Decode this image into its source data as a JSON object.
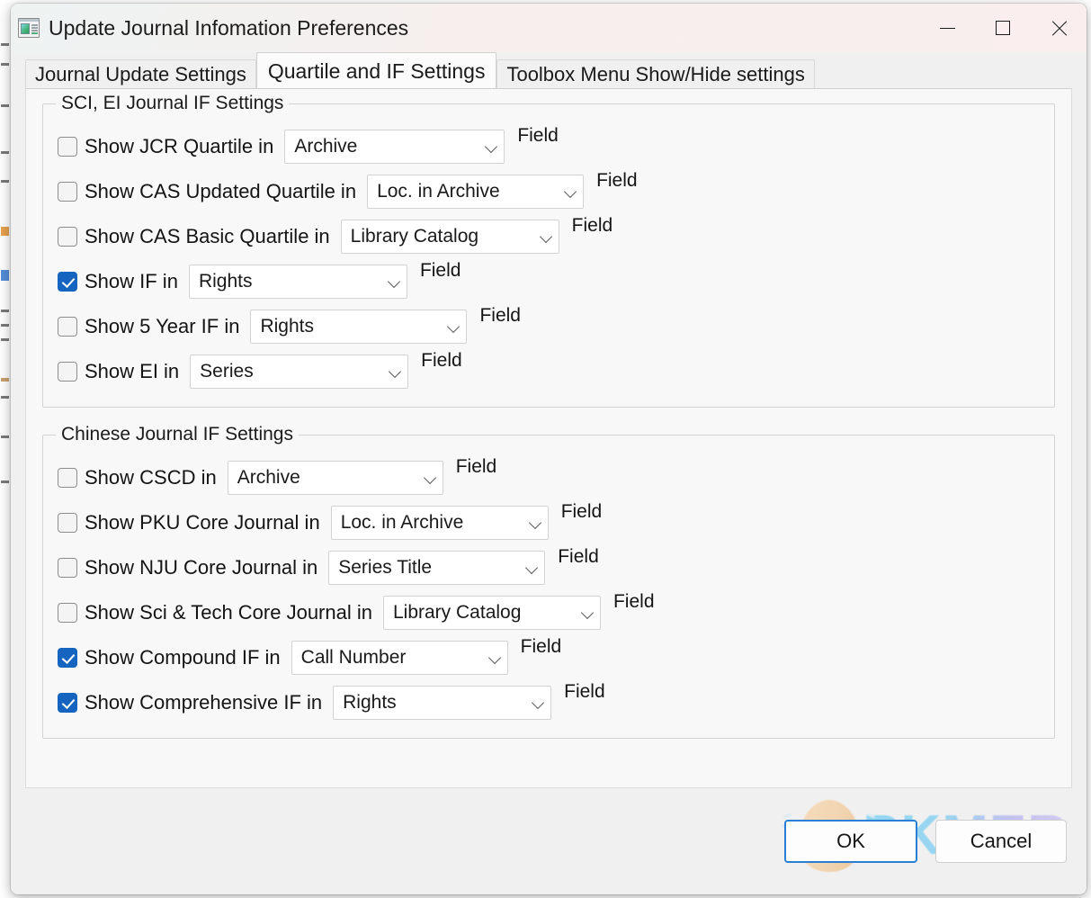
{
  "background": {
    "top_strip_text": "…………………………………………………………………………………"
  },
  "window": {
    "title": "Update Journal Infomation Preferences",
    "icon": "window-preview-icon",
    "controls": {
      "minimize": "minimize-icon",
      "maximize": "maximize-icon",
      "close": "close-icon"
    }
  },
  "tabs": [
    {
      "label": "Journal Update Settings",
      "active": false
    },
    {
      "label": "Quartile and IF Settings",
      "active": true
    },
    {
      "label": "Toolbox Menu Show/Hide settings",
      "active": false
    }
  ],
  "groups": [
    {
      "title": "SCI, EI Journal IF Settings",
      "rows": [
        {
          "label": "Show JCR Quartile in",
          "checked": false,
          "value": "Archive",
          "combo_width": 245,
          "field_label": "Field"
        },
        {
          "label": "Show CAS Updated Quartile in",
          "checked": false,
          "value": "Loc. in Archive",
          "combo_width": 241,
          "field_label": "Field"
        },
        {
          "label": "Show CAS Basic Quartile in",
          "checked": false,
          "value": "Library Catalog",
          "combo_width": 243,
          "field_label": "Field"
        },
        {
          "label": "Show IF in",
          "checked": true,
          "value": "Rights",
          "combo_width": 243,
          "field_label": "Field"
        },
        {
          "label": "Show 5 Year IF in",
          "checked": false,
          "value": "Rights",
          "combo_width": 241,
          "field_label": "Field"
        },
        {
          "label": "Show EI in",
          "checked": false,
          "value": "Series",
          "combo_width": 243,
          "field_label": "Field"
        }
      ]
    },
    {
      "title": "Chinese Journal IF Settings",
      "rows": [
        {
          "label": "Show CSCD in",
          "checked": false,
          "value": "Archive",
          "combo_width": 240,
          "field_label": "Field"
        },
        {
          "label": "Show PKU Core Journal in",
          "checked": false,
          "value": "Loc. in Archive",
          "combo_width": 242,
          "field_label": "Field"
        },
        {
          "label": "Show NJU Core Journal in",
          "checked": false,
          "value": "Series Title",
          "combo_width": 241,
          "field_label": "Field"
        },
        {
          "label": "Show Sci & Tech Core Journal in",
          "checked": false,
          "value": "Library Catalog",
          "combo_width": 242,
          "field_label": "Field"
        },
        {
          "label": "Show Compound IF in",
          "checked": true,
          "value": "Call Number",
          "combo_width": 241,
          "field_label": "Field"
        },
        {
          "label": "Show Comprehensive IF in",
          "checked": true,
          "value": "Rights",
          "combo_width": 243,
          "field_label": "Field"
        }
      ]
    }
  ],
  "footer": {
    "ok_label": "OK",
    "cancel_label": "Cancel"
  },
  "watermark": {
    "text": "PKMER",
    "logo": "cracked-egg-logo"
  },
  "colors": {
    "accent": "#1565c0",
    "focus_border": "#2a7fd4",
    "titlebar_start": "#eef3f2",
    "titlebar_end": "#faeeee",
    "panel_bg": "#f8f8f8",
    "dialog_bg": "#f0f0f0",
    "group_border": "#d3d3d3"
  }
}
